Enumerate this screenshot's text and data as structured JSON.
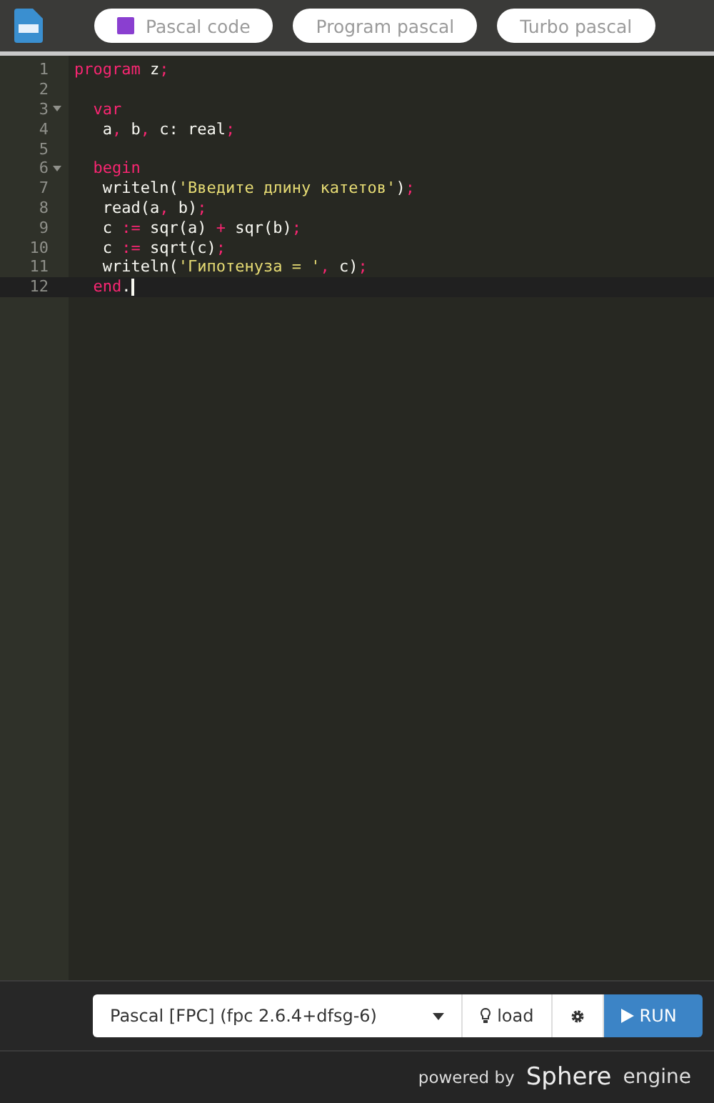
{
  "header": {
    "tabs": [
      {
        "label": "Pascal code",
        "has_icon": true
      },
      {
        "label": "Program pascal",
        "has_icon": false
      },
      {
        "label": "Turbo pascal",
        "has_icon": false
      }
    ]
  },
  "editor": {
    "lines": [
      {
        "number": "1",
        "foldable": false,
        "active": false,
        "cursor": false,
        "tokens": [
          {
            "kind": "keyword",
            "text": "program"
          },
          {
            "kind": "plain",
            "text": " z"
          },
          {
            "kind": "punct",
            "text": ";"
          }
        ]
      },
      {
        "number": "2",
        "foldable": false,
        "active": false,
        "cursor": false
      },
      {
        "number": "3",
        "foldable": true,
        "active": false,
        "cursor": false,
        "tokens": [
          {
            "kind": "keyword",
            "text": "  var"
          }
        ]
      },
      {
        "number": "4",
        "foldable": false,
        "active": false,
        "cursor": false,
        "tokens": [
          {
            "kind": "plain",
            "text": "   a"
          },
          {
            "kind": "punct",
            "text": ","
          },
          {
            "kind": "plain",
            "text": " b"
          },
          {
            "kind": "punct",
            "text": ","
          },
          {
            "kind": "plain",
            "text": " c: real"
          },
          {
            "kind": "punct",
            "text": ";"
          }
        ]
      },
      {
        "number": "5",
        "foldable": false,
        "active": false,
        "cursor": false
      },
      {
        "number": "6",
        "foldable": true,
        "active": false,
        "cursor": false,
        "tokens": [
          {
            "kind": "keyword",
            "text": "  begin"
          }
        ]
      },
      {
        "number": "7",
        "foldable": false,
        "active": false,
        "cursor": false,
        "tokens": [
          {
            "kind": "plain",
            "text": "   writeln("
          },
          {
            "kind": "string",
            "text": "'Введите длину катетов'"
          },
          {
            "kind": "plain",
            "text": ")"
          },
          {
            "kind": "punct",
            "text": ";"
          }
        ]
      },
      {
        "number": "8",
        "foldable": false,
        "active": false,
        "cursor": false,
        "tokens": [
          {
            "kind": "plain",
            "text": "   read(a"
          },
          {
            "kind": "punct",
            "text": ","
          },
          {
            "kind": "plain",
            "text": " b)"
          },
          {
            "kind": "punct",
            "text": ";"
          }
        ]
      },
      {
        "number": "9",
        "foldable": false,
        "active": false,
        "cursor": false,
        "tokens": [
          {
            "kind": "plain",
            "text": "   c "
          },
          {
            "kind": "punct",
            "text": ":="
          },
          {
            "kind": "plain",
            "text": " sqr(a) "
          },
          {
            "kind": "punct",
            "text": "+"
          },
          {
            "kind": "plain",
            "text": " sqr(b)"
          },
          {
            "kind": "punct",
            "text": ";"
          }
        ]
      },
      {
        "number": "10",
        "foldable": false,
        "active": false,
        "cursor": false,
        "tokens": [
          {
            "kind": "plain",
            "text": "   c "
          },
          {
            "kind": "punct",
            "text": ":="
          },
          {
            "kind": "plain",
            "text": " sqrt(c)"
          },
          {
            "kind": "punct",
            "text": ";"
          }
        ]
      },
      {
        "number": "11",
        "foldable": false,
        "active": false,
        "cursor": false,
        "tokens": [
          {
            "kind": "plain",
            "text": "   writeln("
          },
          {
            "kind": "string",
            "text": "'Гипотенуза = '"
          },
          {
            "kind": "punct",
            "text": ","
          },
          {
            "kind": "plain",
            "text": " c)"
          },
          {
            "kind": "punct",
            "text": ";"
          }
        ]
      },
      {
        "number": "12",
        "foldable": false,
        "active": true,
        "cursor": true,
        "tokens": [
          {
            "kind": "keyword",
            "text": "  end"
          },
          {
            "kind": "plain",
            "text": "."
          }
        ]
      }
    ]
  },
  "toolbar": {
    "language": "Pascal [FPC] (fpc 2.6.4+dfsg-6)",
    "load": "load",
    "run": "RUN"
  },
  "footer": {
    "powered_by": "powered by",
    "brand": "Sphere",
    "brand_suffix": "engine"
  }
}
